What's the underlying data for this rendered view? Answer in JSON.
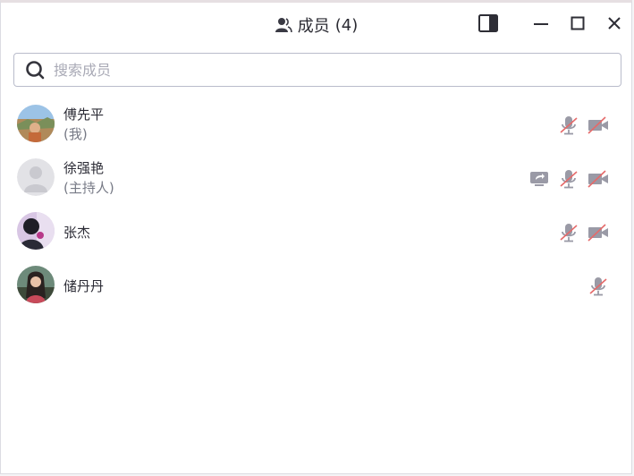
{
  "window": {
    "title": "成员",
    "count": "(4)"
  },
  "search": {
    "placeholder": "搜索成员",
    "value": ""
  },
  "members": [
    {
      "name": "傅先平",
      "role": "(我)",
      "status_icons": [
        "mic-muted-icon",
        "camera-off-icon"
      ]
    },
    {
      "name": "徐强艳",
      "role": "(主持人)",
      "status_icons": [
        "screen-share-icon",
        "mic-muted-icon",
        "camera-off-icon"
      ]
    },
    {
      "name": "张杰",
      "role": "",
      "status_icons": [
        "mic-muted-icon",
        "camera-off-icon"
      ]
    },
    {
      "name": "储丹丹",
      "role": "",
      "status_icons": [
        "mic-muted-icon"
      ]
    }
  ],
  "colors": {
    "muted_slash": "#e56a6a",
    "icon_gray": "#9a9aa6",
    "title_text": "#2b2b33"
  }
}
